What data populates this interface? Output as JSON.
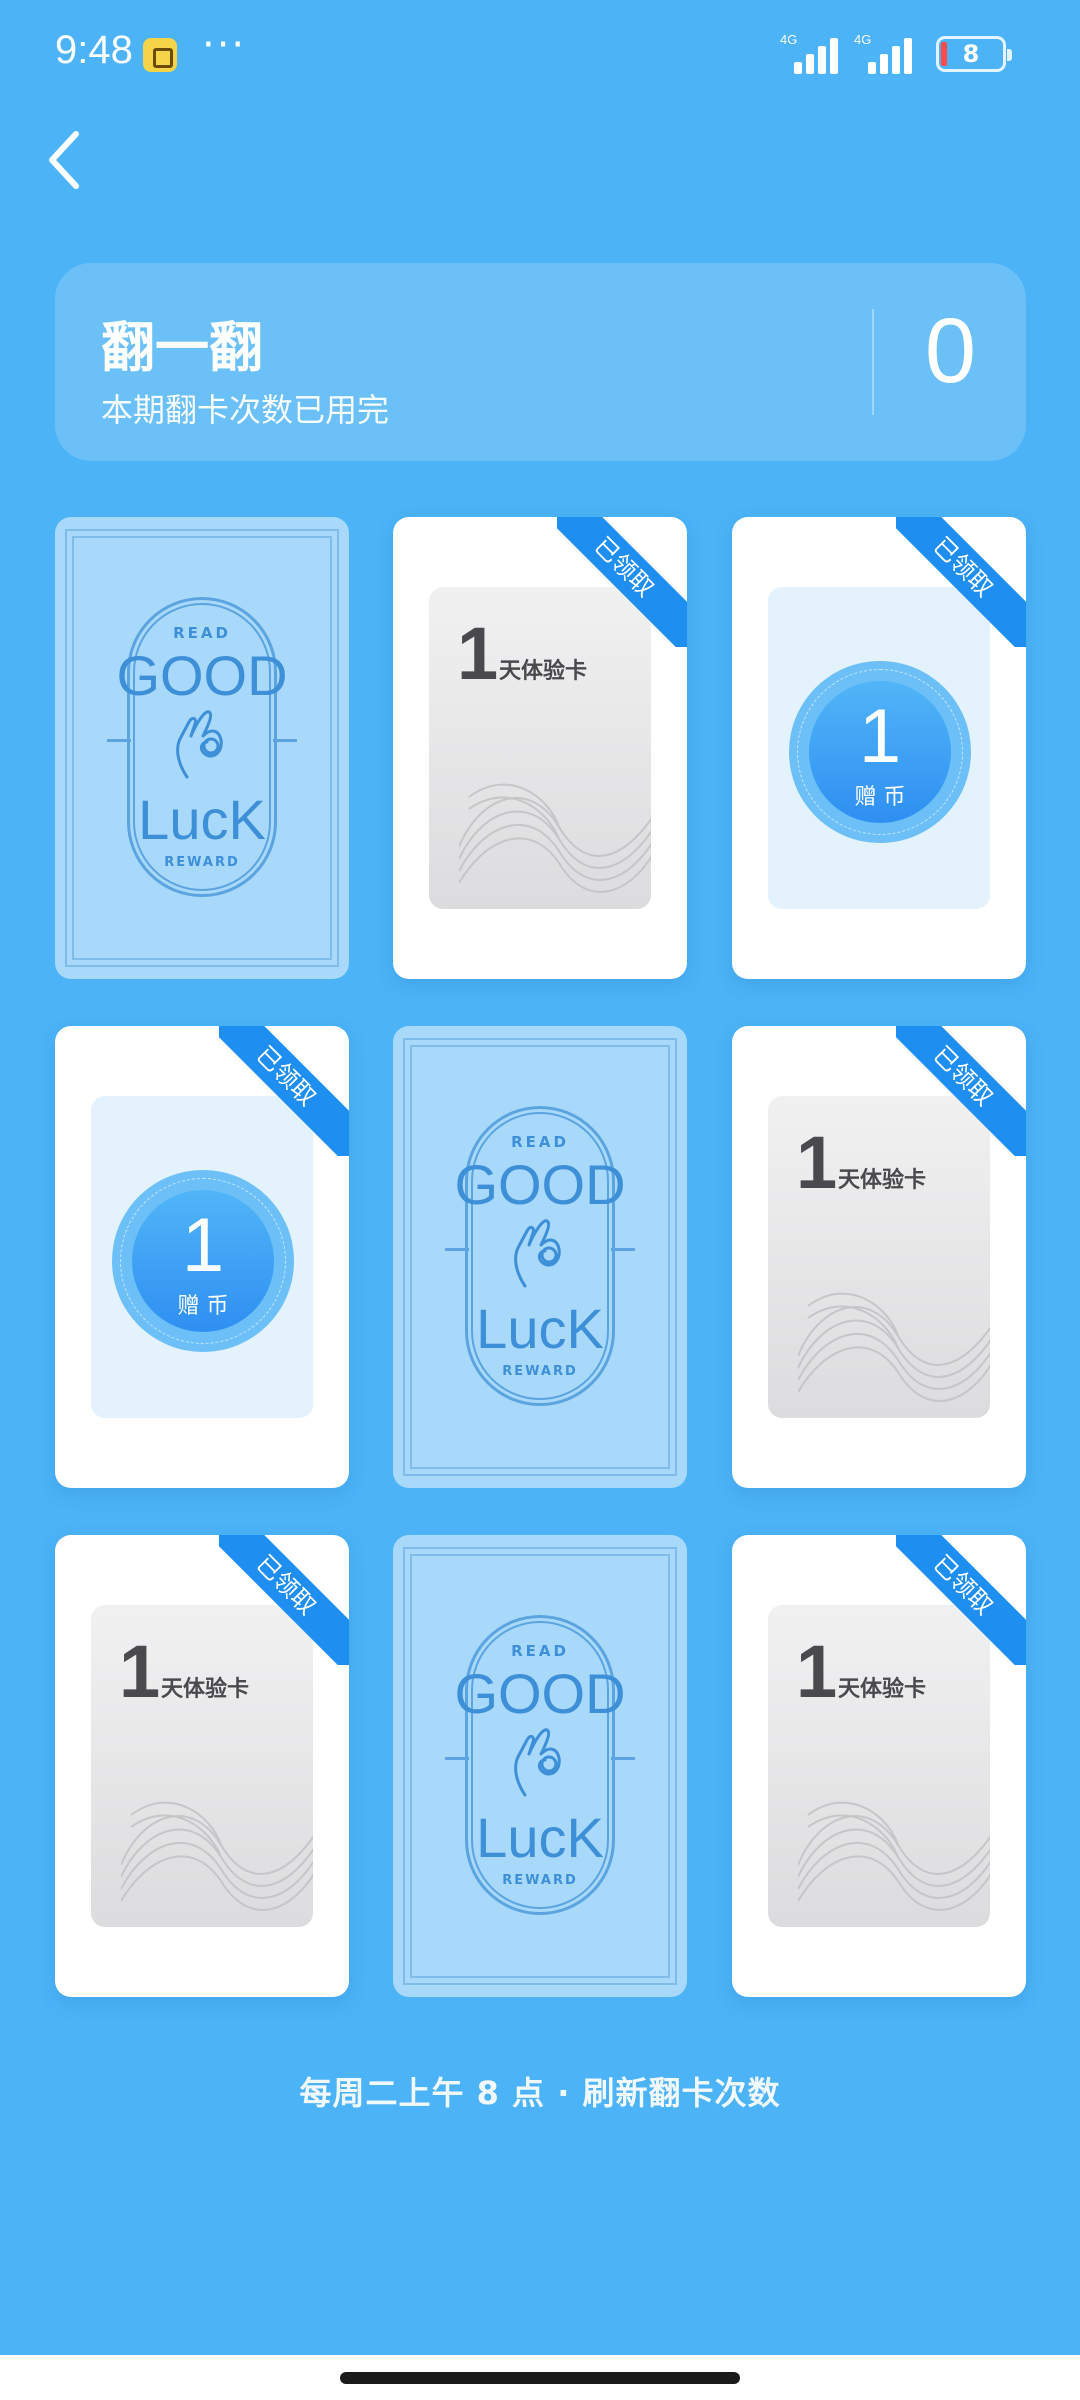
{
  "status_bar": {
    "time": "9:48",
    "more": "···",
    "signal1_label": "4G",
    "signal2_label": "4G",
    "battery": "8",
    "notification_icon": "lock-bag-icon"
  },
  "nav": {
    "back_icon": "chevron-left-icon"
  },
  "header": {
    "title": "翻一翻",
    "subtitle": "本期翻卡次数已用完",
    "count": "0"
  },
  "card_back": {
    "read": "READ",
    "good": "GOOD",
    "luck": "LucK",
    "reward": "REWARD"
  },
  "cards": [
    {
      "state": "face-down"
    },
    {
      "state": "claimed",
      "type": "trial",
      "amount": "1",
      "label": "天体验卡",
      "badge": "已领取"
    },
    {
      "state": "claimed",
      "type": "coin",
      "amount": "1",
      "label": "赠 币",
      "badge": "已领取"
    },
    {
      "state": "claimed",
      "type": "coin",
      "amount": "1",
      "label": "赠 币",
      "badge": "已领取"
    },
    {
      "state": "face-down"
    },
    {
      "state": "claimed",
      "type": "trial",
      "amount": "1",
      "label": "天体验卡",
      "badge": "已领取"
    },
    {
      "state": "claimed",
      "type": "trial",
      "amount": "1",
      "label": "天体验卡",
      "badge": "已领取"
    },
    {
      "state": "face-down"
    },
    {
      "state": "claimed",
      "type": "trial",
      "amount": "1",
      "label": "天体验卡",
      "badge": "已领取"
    }
  ],
  "footer": {
    "text": "每周二上午 8 点 · 刷新翻卡次数"
  },
  "colors": {
    "background": "#4cb3f7",
    "ribbon": "#1e8ef0",
    "card_back": "#a8d8fa"
  }
}
